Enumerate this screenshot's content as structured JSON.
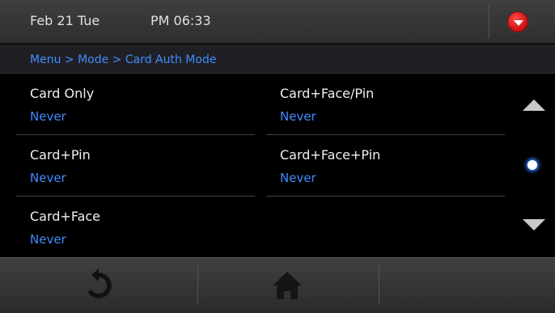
{
  "header": {
    "date": "Feb 21 Tue",
    "time": "PM 06:33",
    "dropdown_icon": "chevron-down-icon"
  },
  "breadcrumb": "Menu > Mode > Card Auth Mode",
  "items": [
    {
      "label": "Card Only",
      "value": "Never"
    },
    {
      "label": "Card+Face/Pin",
      "value": "Never"
    },
    {
      "label": "Card+Pin",
      "value": "Never"
    },
    {
      "label": "Card+Face+Pin",
      "value": "Never"
    },
    {
      "label": "Card+Face",
      "value": "Never"
    }
  ],
  "scroll": {
    "up_icon": "triangle-up-icon",
    "indicator_icon": "dot-indicator-icon",
    "down_icon": "triangle-down-icon"
  },
  "footer": {
    "back_icon": "refresh-back-icon",
    "home_icon": "home-icon"
  },
  "colors": {
    "accent": "#3f8cff",
    "alert": "#e01b1b"
  }
}
